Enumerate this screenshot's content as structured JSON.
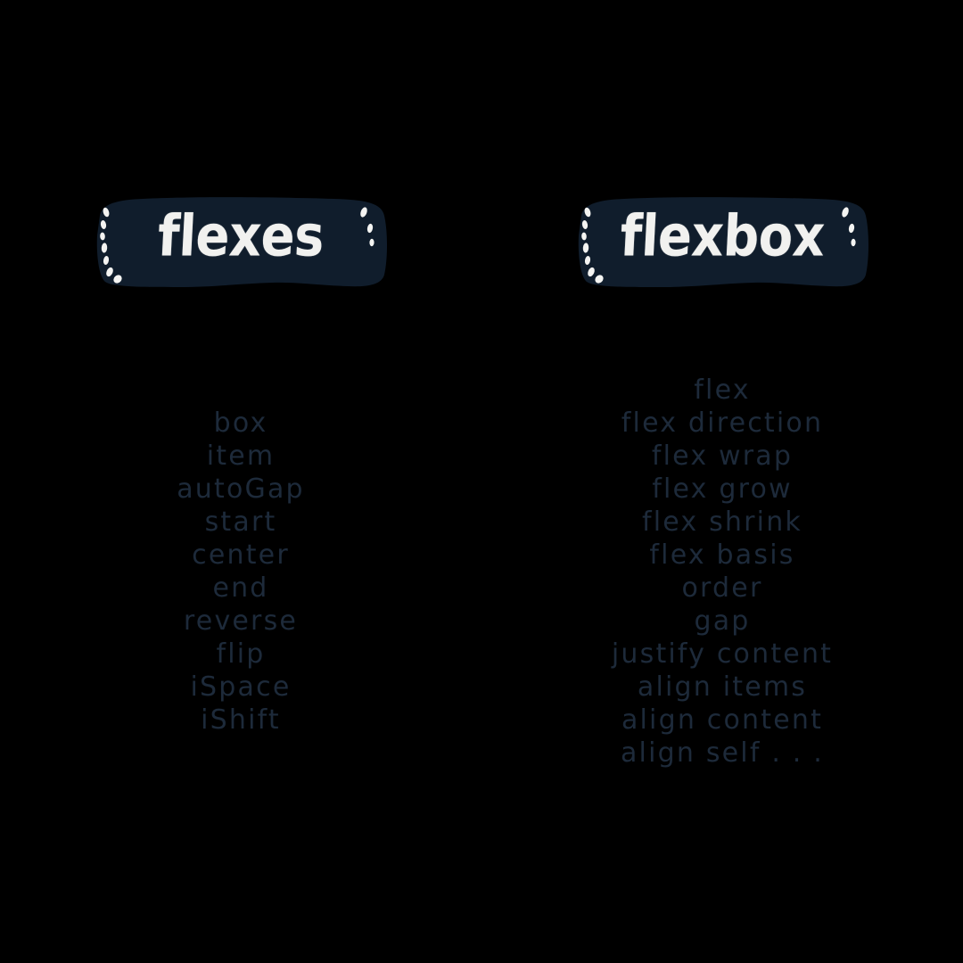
{
  "canvas": {
    "background_color": "#000000",
    "text_color": "#1d2a3a",
    "badge_background_color": "#101d2c",
    "badge_text_color": "#f1f1ef"
  },
  "columns": [
    {
      "id": "flexes",
      "badge_label": "flexes",
      "keywords": [
        "box",
        "item",
        "autoGap",
        "start",
        "center",
        "end",
        "reverse",
        "flip",
        "iSpace",
        "iShift"
      ]
    },
    {
      "id": "flexbox",
      "badge_label": "flexbox",
      "keywords": [
        "flex",
        "flex direction",
        "flex wrap",
        "flex grow",
        "flex shrink",
        "flex basis",
        "order",
        "gap",
        "justify content",
        "align items",
        "align content",
        "align self . . ."
      ]
    }
  ]
}
